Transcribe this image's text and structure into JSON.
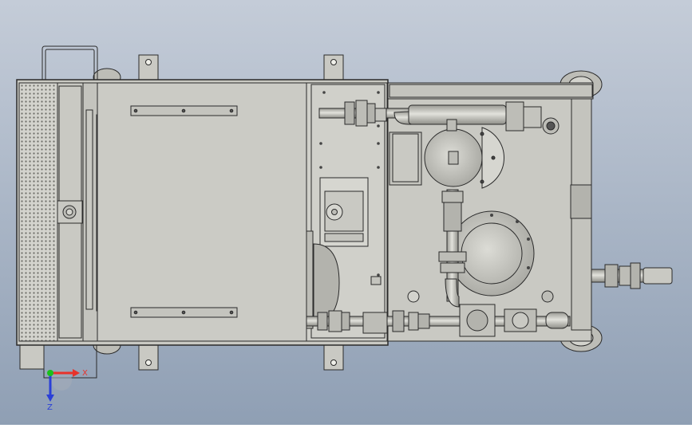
{
  "viewport": {
    "background_top": "#c4ccd8",
    "background_bottom": "#8f9fb4"
  },
  "model": {
    "body_color": "#c9c9c3",
    "panel_color": "#d3d3cd",
    "line_color": "#2a2a2a",
    "pipe_color": "#bdbdb7",
    "perforation_color": "#6b6b66"
  },
  "triad": {
    "x_label": "X",
    "z_label": "Z",
    "x_color": "#e8322a",
    "z_color": "#2a3fd8",
    "origin_color": "#19c11c"
  }
}
